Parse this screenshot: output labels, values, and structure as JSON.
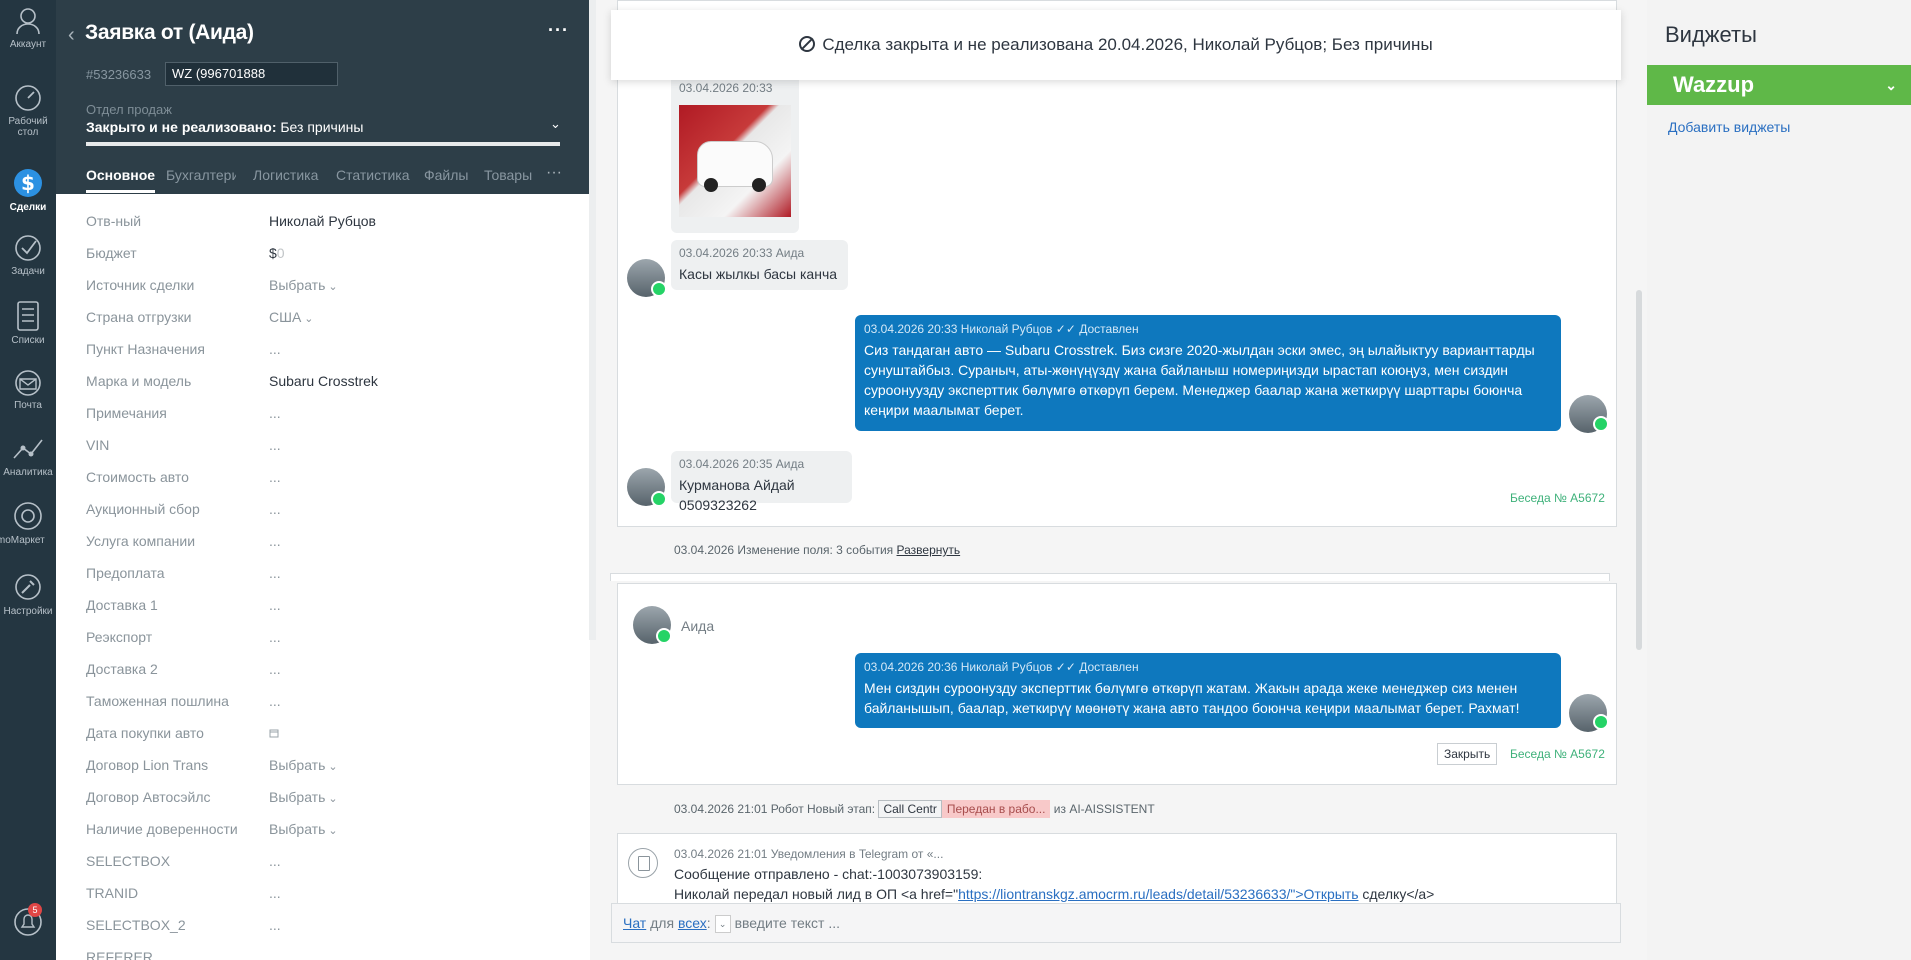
{
  "nav": {
    "items": [
      {
        "label": "Аккаунт",
        "icon": "account-icon"
      },
      {
        "label": "Рабочий стол",
        "icon": "dashboard-icon"
      },
      {
        "label": "Сделки",
        "icon": "deals-icon"
      },
      {
        "label": "Задачи",
        "icon": "tasks-icon"
      },
      {
        "label": "Списки",
        "icon": "lists-icon"
      },
      {
        "label": "Почта",
        "icon": "mail-icon"
      },
      {
        "label": "Аналитика",
        "icon": "analytics-icon"
      },
      {
        "label": "amoМаркет",
        "icon": "market-icon"
      },
      {
        "label": "Настройки",
        "icon": "settings-icon"
      }
    ],
    "notifications_count": "5"
  },
  "lead": {
    "title": "Заявка от (Аида)",
    "id": "#53236633",
    "tag": "WZ (996701888",
    "pipeline_label": "Отдел продаж",
    "status_bold": "Закрыто и не реализовано:",
    "status_reason": " Без причины",
    "tabs": [
      "Основное",
      "Бухгалтерия",
      "Логистика",
      "Статистика",
      "Файлы",
      "Товары"
    ],
    "fields": [
      {
        "label": "Отв-ный",
        "value": "Николай Рубцов",
        "type": "text"
      },
      {
        "label": "Бюджет",
        "value": "$",
        "value_extra": "0",
        "type": "budget"
      },
      {
        "label": "Источник сделки",
        "value": "Выбрать",
        "type": "select"
      },
      {
        "label": "Страна отгрузки",
        "value": "США",
        "type": "select"
      },
      {
        "label": "Пункт Назначения",
        "value": "...",
        "type": "empty"
      },
      {
        "label": "Марка и модель",
        "value": "Subaru Crosstrek",
        "type": "text"
      },
      {
        "label": "Примечания",
        "value": "...",
        "type": "empty"
      },
      {
        "label": "VIN",
        "value": "...",
        "type": "empty"
      },
      {
        "label": "Стоимость авто",
        "value": "...",
        "type": "empty"
      },
      {
        "label": "Аукционный сбор",
        "value": "...",
        "type": "empty"
      },
      {
        "label": "Услуга компании",
        "value": "...",
        "type": "empty"
      },
      {
        "label": "Предоплата",
        "value": "...",
        "type": "empty"
      },
      {
        "label": "Доставка 1",
        "value": "...",
        "type": "empty"
      },
      {
        "label": "Реэкспорт",
        "value": "...",
        "type": "empty"
      },
      {
        "label": "Доставка 2",
        "value": "...",
        "type": "empty"
      },
      {
        "label": "Таможенная пошлина",
        "value": "...",
        "type": "empty"
      },
      {
        "label": "Дата покупки авто",
        "value": "",
        "type": "date"
      },
      {
        "label": "Договор Lion Trans",
        "value": "Выбрать",
        "type": "select"
      },
      {
        "label": "Договор Автосэйлс",
        "value": "Выбрать",
        "type": "select"
      },
      {
        "label": "Наличие доверенности",
        "value": "Выбрать",
        "type": "select"
      },
      {
        "label": "SELECTBOX",
        "value": "...",
        "type": "empty"
      },
      {
        "label": "TRANID",
        "value": "...",
        "type": "empty"
      },
      {
        "label": "SELECTBOX_2",
        "value": "...",
        "type": "empty"
      },
      {
        "label": "REFERER",
        "value": "...",
        "type": "empty"
      }
    ]
  },
  "feed": {
    "closed_banner": "Сделка закрыта и не реализована 20.04.2026, Николай Рубцов; Без причины",
    "image_message_meta": "03.04.2026 20:33",
    "msg1": {
      "meta": "03.04.2026 20:33 Аида",
      "text": "Касы жылкы басы канча"
    },
    "msg2": {
      "meta": "03.04.2026 20:33 Николай Рубцов",
      "status": "✓✓ Доставлен",
      "lines": [
        "Сиз тандаган авто — Subaru Crosstrek. Биз сизге 2020-жылдан эски эмес, эң ылайыктуу варианттарды",
        "сунуштайбыз. Сураныч, аты-жөнүңүздү жана байланыш номериңизди ырастап коюңуз, мен сиздин",
        "суроонуузду эксперттик бөлүмгө өткөрүп берем. Менеджер баалар жана жеткирүү шарттары боюнча",
        "кеңири маалымат берет."
      ]
    },
    "msg3": {
      "meta": "03.04.2026 20:35 Аида",
      "text": "Курманова Айдай 0509323262"
    },
    "conv1_link": "Беседа № А5672",
    "field_change": {
      "text": "03.04.2026 Изменение поля: 3 события ",
      "link": "Развернуть"
    },
    "conv2_name": "Аида",
    "msg4": {
      "meta": "03.04.2026 20:36 Николай Рубцов",
      "status": "✓✓ Доставлен",
      "lines": [
        "Мен сиздин суроонузду эксперттик бөлүмгө өткөрүп жатам. Жакын арада жеке менеджер сиз менен",
        "байланышып, баалар, жеткирүү мөөнөтү жана авто тандоо боюнча кеңири маалымат берет. Рахмат!"
      ]
    },
    "close_button": "Закрыть",
    "conv2_link": "Беседа № А5672",
    "robot_line": {
      "text": "03.04.2026 21:01 Робот Новый этап: ",
      "from_stage": "Call Centr",
      "to_stage": "Передан в рабо...",
      "suffix": " из AI-AISSISTENT"
    },
    "telegram": {
      "meta": "03.04.2026 21:01 Уведомления в Telegram от «...",
      "line1": "Сообщение отправлено - chat:-1003073903159:",
      "line2_prefix": "Николай передал новый лид в ОП <a href=\"",
      "line2_link": "https://liontranskgz.amocrm.ru/leads/detail/53236633/\">Открыть",
      "line2_suffix": " сделку</a>"
    },
    "chat_input": {
      "chat_label": "Чат",
      "for_label": " для ",
      "all_label": "всех",
      "colon": ":",
      "placeholder": "введите текст ..."
    }
  },
  "widgets": {
    "title": "Виджеты",
    "wazzup": "Wazzup",
    "add_label": "Добавить виджеты"
  },
  "colors": {
    "nav_bg": "#243641",
    "header_bg": "#2d3e48",
    "outgoing_bubble": "#0e78be",
    "wazzup_green": "#5fb848",
    "link_green": "#3eb17a"
  }
}
